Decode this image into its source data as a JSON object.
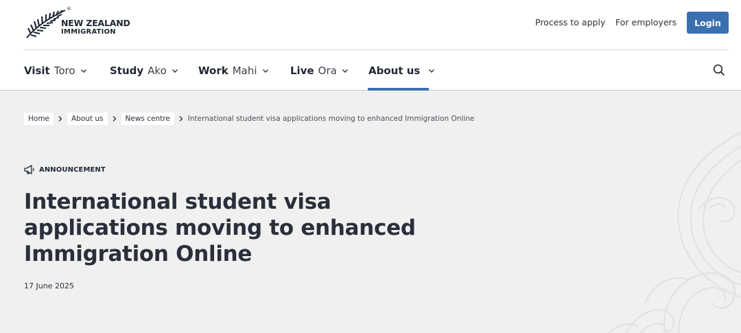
{
  "header": {
    "logo": {
      "line1": "NEW ZEALAND",
      "line2": "IMMIGRATION",
      "reg_mark": "®"
    },
    "utility_links": {
      "process": "Process to apply",
      "employers": "For employers"
    },
    "login_label": "Login"
  },
  "nav": {
    "items": [
      {
        "en": "Visit",
        "mi": "Toro"
      },
      {
        "en": "Study",
        "mi": "Ako"
      },
      {
        "en": "Work",
        "mi": "Mahi"
      },
      {
        "en": "Live",
        "mi": "Ora"
      },
      {
        "en": "About us",
        "mi": ""
      }
    ],
    "active": "About us"
  },
  "breadcrumb": {
    "items": [
      "Home",
      "About us",
      "News centre"
    ],
    "current": "International student visa applications moving to enhanced Immigration Online"
  },
  "article": {
    "category": "ANNOUNCEMENT",
    "title": "International student visa applications moving to enhanced Immigration Online",
    "date": "17 June 2025"
  },
  "colors": {
    "accent": "#3a6fb0",
    "hero_bg": "#f0f0f0",
    "text": "#2b2f3a"
  },
  "icons": {
    "logo": "silver-fern-icon",
    "chevrons": "chevron-down-icon",
    "search": "search-icon",
    "breadcrumb_sep": "chevron-right-icon",
    "category": "megaphone-icon"
  }
}
